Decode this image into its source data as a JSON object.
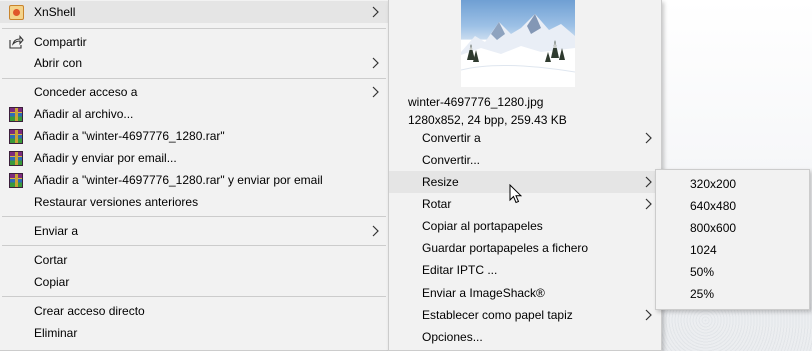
{
  "main_menu": {
    "xnshell": "XnShell",
    "compartir": "Compartir",
    "abrir_con": "Abrir con",
    "conceder_acceso": "Conceder acceso a",
    "anadir_archivo": "Añadir al archivo...",
    "anadir_rar": "Añadir a \"winter-4697776_1280.rar\"",
    "anadir_enviar_email": "Añadir y enviar por email...",
    "anadir_rar_email": "Añadir a \"winter-4697776_1280.rar\" y enviar por email",
    "restaurar": "Restaurar versiones anteriores",
    "enviar_a": "Enviar a",
    "cortar": "Cortar",
    "copiar": "Copiar",
    "crear_acceso": "Crear acceso directo",
    "eliminar": "Eliminar"
  },
  "xn_menu": {
    "filename": "winter-4697776_1280.jpg",
    "details": "1280x852, 24 bpp, 259.43 KB",
    "convertir_a": "Convertir a",
    "convertir": "Convertir...",
    "resize": "Resize",
    "rotar": "Rotar",
    "copiar_portapapeles": "Copiar al portapapeles",
    "guardar_portapapeles": "Guardar portapapeles a fichero",
    "editar_iptc": "Editar IPTC ...",
    "enviar_imageshack": "Enviar a ImageShack®",
    "establecer_papel": "Establecer como papel tapiz",
    "opciones": "Opciones..."
  },
  "resize_menu": {
    "items": [
      "320x200",
      "640x480",
      "800x600",
      "1024",
      "50%",
      "25%"
    ]
  },
  "icons": {
    "xnshell": "xnshell-icon",
    "share": "share-icon",
    "rar": "winrar-icon",
    "submenu": "chevron-right-icon",
    "cursor": "mouse-cursor-icon"
  }
}
